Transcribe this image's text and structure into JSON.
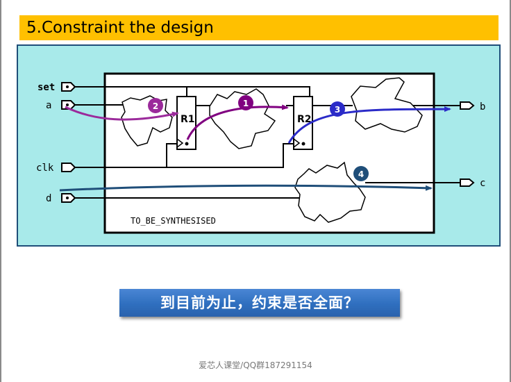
{
  "slide": {
    "title": "5.Constraint the design",
    "question": "到目前为止，约束是否全面？",
    "footer": "爱芯人课堂/QQ群187291154"
  },
  "diagram": {
    "block_label": "TO_BE_SYNTHESISED",
    "ports": {
      "set": "set",
      "a": "a",
      "clk": "clk",
      "d": "d",
      "b": "b",
      "c": "c"
    },
    "registers": {
      "r1": "R1",
      "r2": "R2"
    },
    "paths": [
      {
        "number": "1",
        "color": "#800080"
      },
      {
        "number": "2",
        "color": "#9b2a9b"
      },
      {
        "number": "3",
        "color": "#2b2bc8"
      },
      {
        "number": "4",
        "color": "#1f4e79"
      }
    ],
    "colors": {
      "panel": "#a8eaea",
      "panel_border": "#1f4e79",
      "title_bar": "#ffc000",
      "banner": "#2f6fbf"
    }
  }
}
